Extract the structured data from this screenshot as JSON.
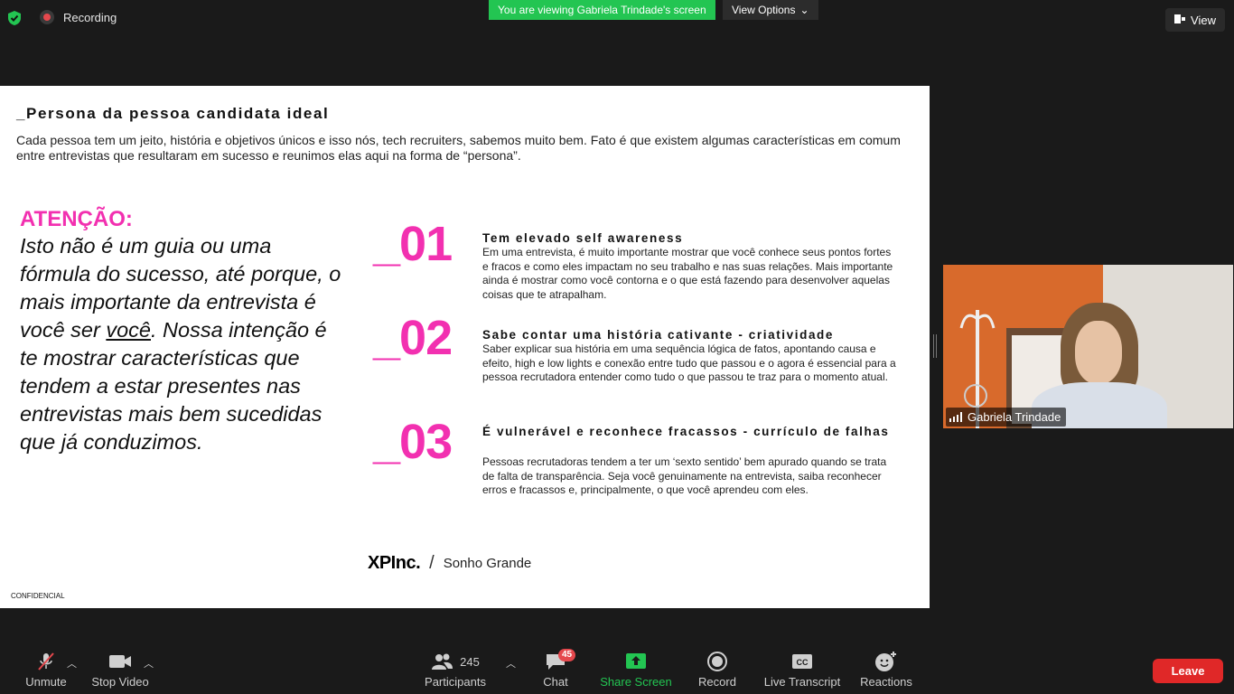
{
  "topbar": {
    "recording_label": "Recording",
    "viewing_banner": "You are viewing Gabriela Trindade's screen",
    "view_options_label": "View Options",
    "view_button_label": "View"
  },
  "slide": {
    "title": "_Persona da pessoa candidata ideal",
    "intro": "Cada pessoa tem um jeito, história e objetivos únicos e isso nós, tech recruiters, sabemos muito bem. Fato é que existem algumas características em comum entre entrevistas que resultaram em sucesso e reunimos elas aqui na forma de “persona”.",
    "attention_label": "ATENÇÃO:",
    "attention_text_before": "Isto não é um guia ou uma fórmula do sucesso, até porque, o mais importante da entrevista é você ser ",
    "attention_text_underlined": "você",
    "attention_text_after": ". Nossa intenção é te mostrar características que tendem a estar presentes nas entrevistas mais bem sucedidas que já conduzimos.",
    "items": [
      {
        "number": "_01",
        "heading": "Tem elevado self awareness",
        "body": "Em uma entrevista, é muito importante mostrar que você conhece seus pontos fortes e fracos e como eles impactam no seu trabalho e nas suas relações. Mais importante ainda é mostrar como você contorna e o que está fazendo para desenvolver aquelas coisas que te atrapalham."
      },
      {
        "number": "_02",
        "heading": "Sabe contar uma história cativante - criatividade",
        "body": "Saber explicar sua história em uma sequência lógica de fatos, apontando causa e efeito, high e low lights e conexão entre tudo que passou e o agora é essencial para a pessoa recrutadora entender como tudo o que passou te traz para o momento atual."
      },
      {
        "number": "_03",
        "heading": "É vulnerável e reconhece fracassos - currículo de falhas",
        "body": "Pessoas recrutadoras tendem a ter um ‘sexto sentido’ bem apurado quando se trata de falta de transparência. Seja você genuinamente na entrevista, saiba reconhecer erros e fracassos e, principalmente, o que você aprendeu com eles."
      }
    ],
    "logo_text": "XPInc.",
    "logo_slash": "/",
    "logo_tagline": "Sonho Grande",
    "confidential": "CONFIDENCIAL"
  },
  "video": {
    "participant_name": "Gabriela Trindade"
  },
  "toolbar": {
    "unmute_label": "Unmute",
    "stop_video_label": "Stop Video",
    "participants_label": "Participants",
    "participants_count": "245",
    "chat_label": "Chat",
    "chat_badge": "45",
    "share_screen_label": "Share Screen",
    "record_label": "Record",
    "live_transcript_label": "Live Transcript",
    "reactions_label": "Reactions",
    "leave_label": "Leave"
  },
  "colors": {
    "accent_pink": "#f230b0",
    "share_green": "#23c552",
    "leave_red": "#e02828"
  }
}
